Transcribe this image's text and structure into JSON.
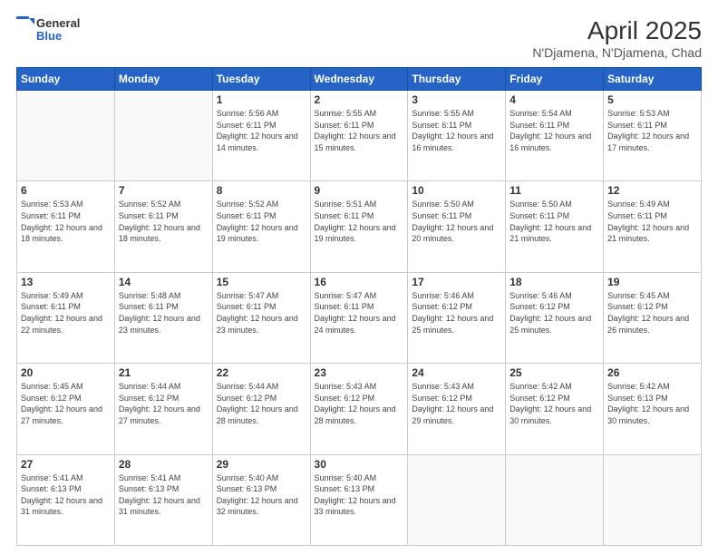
{
  "header": {
    "logo": {
      "general": "General",
      "blue": "Blue"
    },
    "title": "April 2025",
    "subtitle": "N'Djamena, N'Djamena, Chad"
  },
  "weekdays": [
    "Sunday",
    "Monday",
    "Tuesday",
    "Wednesday",
    "Thursday",
    "Friday",
    "Saturday"
  ],
  "weeks": [
    [
      {
        "day": "",
        "info": ""
      },
      {
        "day": "",
        "info": ""
      },
      {
        "day": "1",
        "info": "Sunrise: 5:56 AM\nSunset: 6:11 PM\nDaylight: 12 hours and 14 minutes."
      },
      {
        "day": "2",
        "info": "Sunrise: 5:55 AM\nSunset: 6:11 PM\nDaylight: 12 hours and 15 minutes."
      },
      {
        "day": "3",
        "info": "Sunrise: 5:55 AM\nSunset: 6:11 PM\nDaylight: 12 hours and 16 minutes."
      },
      {
        "day": "4",
        "info": "Sunrise: 5:54 AM\nSunset: 6:11 PM\nDaylight: 12 hours and 16 minutes."
      },
      {
        "day": "5",
        "info": "Sunrise: 5:53 AM\nSunset: 6:11 PM\nDaylight: 12 hours and 17 minutes."
      }
    ],
    [
      {
        "day": "6",
        "info": "Sunrise: 5:53 AM\nSunset: 6:11 PM\nDaylight: 12 hours and 18 minutes."
      },
      {
        "day": "7",
        "info": "Sunrise: 5:52 AM\nSunset: 6:11 PM\nDaylight: 12 hours and 18 minutes."
      },
      {
        "day": "8",
        "info": "Sunrise: 5:52 AM\nSunset: 6:11 PM\nDaylight: 12 hours and 19 minutes."
      },
      {
        "day": "9",
        "info": "Sunrise: 5:51 AM\nSunset: 6:11 PM\nDaylight: 12 hours and 19 minutes."
      },
      {
        "day": "10",
        "info": "Sunrise: 5:50 AM\nSunset: 6:11 PM\nDaylight: 12 hours and 20 minutes."
      },
      {
        "day": "11",
        "info": "Sunrise: 5:50 AM\nSunset: 6:11 PM\nDaylight: 12 hours and 21 minutes."
      },
      {
        "day": "12",
        "info": "Sunrise: 5:49 AM\nSunset: 6:11 PM\nDaylight: 12 hours and 21 minutes."
      }
    ],
    [
      {
        "day": "13",
        "info": "Sunrise: 5:49 AM\nSunset: 6:11 PM\nDaylight: 12 hours and 22 minutes."
      },
      {
        "day": "14",
        "info": "Sunrise: 5:48 AM\nSunset: 6:11 PM\nDaylight: 12 hours and 23 minutes."
      },
      {
        "day": "15",
        "info": "Sunrise: 5:47 AM\nSunset: 6:11 PM\nDaylight: 12 hours and 23 minutes."
      },
      {
        "day": "16",
        "info": "Sunrise: 5:47 AM\nSunset: 6:11 PM\nDaylight: 12 hours and 24 minutes."
      },
      {
        "day": "17",
        "info": "Sunrise: 5:46 AM\nSunset: 6:12 PM\nDaylight: 12 hours and 25 minutes."
      },
      {
        "day": "18",
        "info": "Sunrise: 5:46 AM\nSunset: 6:12 PM\nDaylight: 12 hours and 25 minutes."
      },
      {
        "day": "19",
        "info": "Sunrise: 5:45 AM\nSunset: 6:12 PM\nDaylight: 12 hours and 26 minutes."
      }
    ],
    [
      {
        "day": "20",
        "info": "Sunrise: 5:45 AM\nSunset: 6:12 PM\nDaylight: 12 hours and 27 minutes."
      },
      {
        "day": "21",
        "info": "Sunrise: 5:44 AM\nSunset: 6:12 PM\nDaylight: 12 hours and 27 minutes."
      },
      {
        "day": "22",
        "info": "Sunrise: 5:44 AM\nSunset: 6:12 PM\nDaylight: 12 hours and 28 minutes."
      },
      {
        "day": "23",
        "info": "Sunrise: 5:43 AM\nSunset: 6:12 PM\nDaylight: 12 hours and 28 minutes."
      },
      {
        "day": "24",
        "info": "Sunrise: 5:43 AM\nSunset: 6:12 PM\nDaylight: 12 hours and 29 minutes."
      },
      {
        "day": "25",
        "info": "Sunrise: 5:42 AM\nSunset: 6:12 PM\nDaylight: 12 hours and 30 minutes."
      },
      {
        "day": "26",
        "info": "Sunrise: 5:42 AM\nSunset: 6:13 PM\nDaylight: 12 hours and 30 minutes."
      }
    ],
    [
      {
        "day": "27",
        "info": "Sunrise: 5:41 AM\nSunset: 6:13 PM\nDaylight: 12 hours and 31 minutes."
      },
      {
        "day": "28",
        "info": "Sunrise: 5:41 AM\nSunset: 6:13 PM\nDaylight: 12 hours and 31 minutes."
      },
      {
        "day": "29",
        "info": "Sunrise: 5:40 AM\nSunset: 6:13 PM\nDaylight: 12 hours and 32 minutes."
      },
      {
        "day": "30",
        "info": "Sunrise: 5:40 AM\nSunset: 6:13 PM\nDaylight: 12 hours and 33 minutes."
      },
      {
        "day": "",
        "info": ""
      },
      {
        "day": "",
        "info": ""
      },
      {
        "day": "",
        "info": ""
      }
    ]
  ]
}
